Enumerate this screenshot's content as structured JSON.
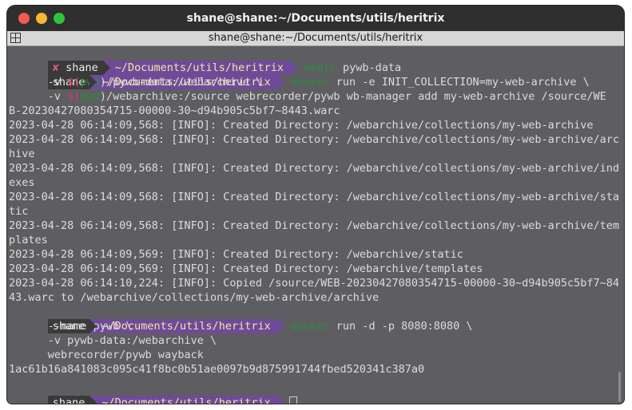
{
  "window": {
    "title": "shane@shane:~/Documents/utils/heritrix",
    "tab_title": "shane@shane:~/Documents/utils/heritrix"
  },
  "colors": {
    "user_segment": "#3a3a3a",
    "path_segment": "#6f4a9a",
    "command": "#2e8b3e",
    "error_x": "#e05a76"
  },
  "prompt": {
    "user": "shane",
    "path": "~/Documents/utils/heritrix",
    "error_mark": "✘"
  },
  "lines": {
    "l1_cmd": "mkdir",
    "l1_arg": " pywb-data",
    "l2_cmd": "docker",
    "l2_arg": " run -e INIT_COLLECTION=my-web-archive \\",
    "l3_pre": "      -v ",
    "l3_d": "$(",
    "l3_pwd": "pwd",
    "l3_post": ")/pywb-data:/webarchive \\",
    "l4_pre": "      -v ",
    "l4_d": "$(",
    "l4_pwd": "pwd",
    "l4_post": ")/webarchive:/source webrecorder/pywb wb-manager add my-web-archive /source/WE",
    "l5": "B-20230427080354715-00000-30~d94b905c5bf7~8443.warc",
    "l6": "2023-04-28 06:14:09,568: [INFO]: Created Directory: /webarchive/collections/my-web-archive",
    "l7": "2023-04-28 06:14:09,568: [INFO]: Created Directory: /webarchive/collections/my-web-archive/arc",
    "l8": "hive",
    "l9": "2023-04-28 06:14:09,568: [INFO]: Created Directory: /webarchive/collections/my-web-archive/ind",
    "l10": "exes",
    "l11": "2023-04-28 06:14:09,568: [INFO]: Created Directory: /webarchive/collections/my-web-archive/sta",
    "l12": "tic",
    "l13": "2023-04-28 06:14:09,568: [INFO]: Created Directory: /webarchive/collections/my-web-archive/tem",
    "l14": "plates",
    "l15": "2023-04-28 06:14:09,569: [INFO]: Created Directory: /webarchive/static",
    "l16": "2023-04-28 06:14:09,569: [INFO]: Created Directory: /webarchive/templates",
    "l17": "2023-04-28 06:14:10,224: [INFO]: Copied /source/WEB-20230427080354715-00000-30~d94b905c5bf7~84",
    "l18": "43.warc to /webarchive/collections/my-web-archive/archive",
    "l19_cmd": "docker",
    "l19_arg": " run -d -p 8080:8080 \\",
    "l20": "      --name pywb \\",
    "l21": "      -v pywb-data:/webarchive \\",
    "l22": "      webrecorder/pywb wayback",
    "l23": "1ac61b16a841083c095c41f8bc0b51ae0097b9d875991744fbed520341c387a0"
  }
}
